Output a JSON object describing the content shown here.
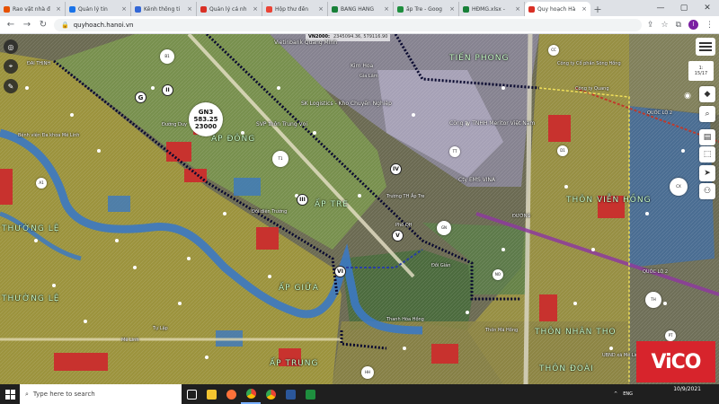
{
  "browser": {
    "tabs": [
      {
        "label": "Rao vặt nhà đ",
        "color": "#e65100",
        "active": false
      },
      {
        "label": "Quản lý tin",
        "color": "#1a73e8",
        "active": false
      },
      {
        "label": "Kênh thông ti",
        "color": "#3367d6",
        "active": false
      },
      {
        "label": "Quản lý cá nh",
        "color": "#d93025",
        "active": false
      },
      {
        "label": "Hộp thư đến",
        "color": "#ea4335",
        "active": false
      },
      {
        "label": "BẢNG HÀNG",
        "color": "#188038",
        "active": false
      },
      {
        "label": "ấp Tre - Goog",
        "color": "#1e8e3e",
        "active": false
      },
      {
        "label": "HĐMG.xlsx -",
        "color": "#188038",
        "active": false
      },
      {
        "label": "Quy hoạch Hà",
        "color": "#d93025",
        "active": true
      }
    ],
    "new_tab": "+",
    "url": "quyhoach.hanoi.vn",
    "avatar_letter": "l"
  },
  "map": {
    "coord_label": "VN2000:",
    "coord_value": "2345094.36, 579116.90",
    "scale_line1": "1:",
    "scale_line2": "15/17",
    "labels": {
      "vietinbank": "Vietinbank Quang Minh",
      "kim_hoa": "Kim Hoa",
      "gia_lam": "Gia Lâm",
      "tien_phong": "TIẾN PHONG",
      "svp": "SVP thôn Trung Vọi",
      "lk_logistics": "SK Logistics - Kho Chuyển Nghiệp",
      "cong_ty_meritor": "Công ty TNHH Meritor Việt Nam",
      "cty_ems": "Cty EMS VINA",
      "ap_dong": "ẤP ĐÔNG",
      "ap_tre": "ẤP TRE",
      "vien_hong": "THÔN VIỄN HỒNG",
      "thuong_le": "THƯỜNG LỆ",
      "thuong_le2": "THƯỜNG LỆ",
      "thon_nhan": "THÔN NHÂN THỌ",
      "thon_doai": "THÔN ĐOÀI",
      "ap_trung": "ẤP TRUNG",
      "quoc_lo": "QUỐC LỘ 2",
      "quoc_lo2": "QUỐC LỘ 2",
      "bv": "Bệnh viện Đa khoa Mê Linh",
      "me_linh": "Mê Linh",
      "ap_giua": "ẤP GIỮA",
      "co_phan": "Công ty Cổ phần Sông Hồng",
      "cong_ty_quang": "Công ty Quang",
      "duong_duy": "Đường Duy",
      "thanh_hoa": "Thanh Hóa Hồng",
      "ubnd": "UBND xã Mê Linh",
      "tb_ap_tre": "Trường TH Ấp Tre",
      "doi_dien": "Đối diện Trường",
      "pho_qh": "Phố QH",
      "thon_ma": "Thôn Mã Hồng",
      "tu_lap": "Tự Lập",
      "dai_thinh": "ĐẠI THỊNH",
      "do_road": "ĐƯỜNG",
      "doi_gian": "Đồi Giản"
    },
    "roman_markers": [
      "G",
      "II",
      "III",
      "IV",
      "V",
      "VI"
    ],
    "gn3": {
      "code": "GN3",
      "area": "583.25",
      "pop": "23000"
    },
    "bubble_texts": [
      "B1",
      "T1",
      "GN",
      "CX",
      "TH",
      "HH",
      "NO",
      "CC",
      "TT",
      "PT",
      "A1",
      "D1"
    ]
  },
  "taskbar": {
    "search_placeholder": "Type here to search",
    "tray_lang": "ENG",
    "time": "",
    "date": "10/9/2021"
  },
  "watermark": {
    "brand": "ViCO"
  }
}
